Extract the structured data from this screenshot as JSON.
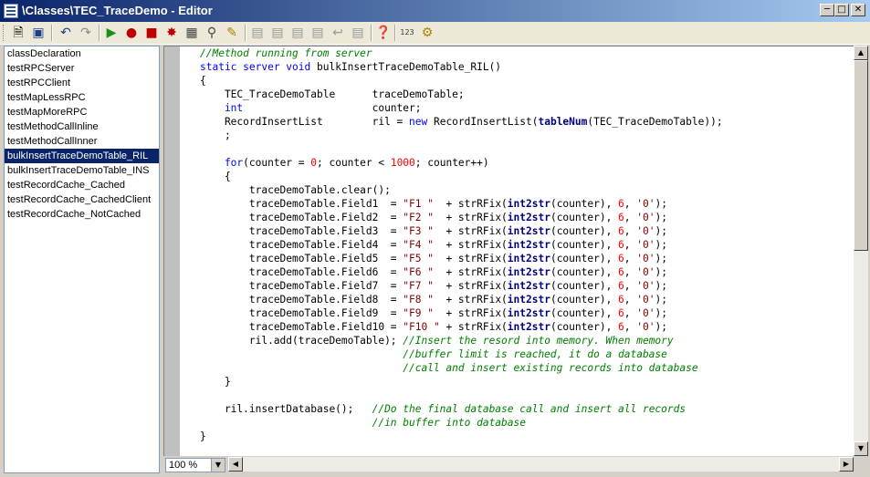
{
  "window": {
    "title": "\\Classes\\TEC_TraceDemo - Editor"
  },
  "toolbar": {
    "icons": [
      "new-icon",
      "save-icon",
      "undo-icon",
      "redo-icon",
      "run-icon",
      "stop-icon",
      "breakpoint-icon",
      "remove-breakpoints-icon",
      "compile-icon",
      "find-icon",
      "replace-icon",
      "lookup-properties-icon",
      "lookup-methods-icon",
      "lookup-labels-icon",
      "comment-icon",
      "uncomment-icon",
      "scripts-icon",
      "help-icon",
      "line-numbers-icon",
      "code-profile-icon"
    ]
  },
  "methods": [
    {
      "label": "classDeclaration"
    },
    {
      "label": "testRPCServer"
    },
    {
      "label": "testRPCClient"
    },
    {
      "label": "testMapLessRPC"
    },
    {
      "label": "testMapMoreRPC"
    },
    {
      "label": "testMethodCallInline"
    },
    {
      "label": "testMethodCallInner"
    },
    {
      "label": "bulkInsertTraceDemoTable_RIL",
      "selected": true
    },
    {
      "label": "bulkInsertTraceDemoTable_INS"
    },
    {
      "label": "testRecordCache_Cached"
    },
    {
      "label": "testRecordCache_CachedClient"
    },
    {
      "label": "testRecordCache_NotCached"
    }
  ],
  "code": {
    "lines": [
      [
        [
          "cm",
          "//Method running from server"
        ]
      ],
      [
        [
          "kw",
          "static server void "
        ],
        [
          "",
          "bulkInsertTraceDemoTable_RIL()"
        ]
      ],
      [
        [
          "",
          "{"
        ]
      ],
      [
        [
          "",
          "    TEC_TraceDemoTable      traceDemoTable;"
        ]
      ],
      [
        [
          "kw",
          "    int"
        ],
        [
          "",
          "                     counter;"
        ]
      ],
      [
        [
          "",
          "    RecordInsertList        ril = "
        ],
        [
          "kw",
          "new"
        ],
        [
          "",
          " RecordInsertList("
        ],
        [
          "fn",
          "tableNum"
        ],
        [
          "",
          "(TEC_TraceDemoTable));"
        ]
      ],
      [
        [
          "",
          "    ;"
        ]
      ],
      [
        [
          "",
          "    "
        ]
      ],
      [
        [
          "kw",
          "    for"
        ],
        [
          "",
          "(counter = "
        ],
        [
          "num",
          "0"
        ],
        [
          "",
          "; counter < "
        ],
        [
          "num",
          "1000"
        ],
        [
          "",
          "; counter++)"
        ]
      ],
      [
        [
          "",
          "    {"
        ]
      ],
      [
        [
          "",
          "        traceDemoTable.clear();"
        ]
      ],
      [
        [
          "",
          "        traceDemoTable.Field1  = "
        ],
        [
          "str",
          "\"F1 \""
        ],
        [
          "",
          "  + strRFix("
        ],
        [
          "fn",
          "int2str"
        ],
        [
          "",
          "(counter), "
        ],
        [
          "num",
          "6"
        ],
        [
          ", ",
          ", "
        ],
        [
          "str",
          "'0'"
        ],
        [
          "",
          ");"
        ]
      ],
      [
        [
          "",
          "        traceDemoTable.Field2  = "
        ],
        [
          "str",
          "\"F2 \""
        ],
        [
          "",
          "  + strRFix("
        ],
        [
          "fn",
          "int2str"
        ],
        [
          "",
          "(counter), "
        ],
        [
          "num",
          "6"
        ],
        [
          "",
          ", "
        ],
        [
          "str",
          "'0'"
        ],
        [
          "",
          ");"
        ]
      ],
      [
        [
          "",
          "        traceDemoTable.Field3  = "
        ],
        [
          "str",
          "\"F3 \""
        ],
        [
          "",
          "  + strRFix("
        ],
        [
          "fn",
          "int2str"
        ],
        [
          "",
          "(counter), "
        ],
        [
          "num",
          "6"
        ],
        [
          "",
          ", "
        ],
        [
          "str",
          "'0'"
        ],
        [
          "",
          ");"
        ]
      ],
      [
        [
          "",
          "        traceDemoTable.Field4  = "
        ],
        [
          "str",
          "\"F4 \""
        ],
        [
          "",
          "  + strRFix("
        ],
        [
          "fn",
          "int2str"
        ],
        [
          "",
          "(counter), "
        ],
        [
          "num",
          "6"
        ],
        [
          "",
          ", "
        ],
        [
          "str",
          "'0'"
        ],
        [
          "",
          ");"
        ]
      ],
      [
        [
          "",
          "        traceDemoTable.Field5  = "
        ],
        [
          "str",
          "\"F5 \""
        ],
        [
          "",
          "  + strRFix("
        ],
        [
          "fn",
          "int2str"
        ],
        [
          "",
          "(counter), "
        ],
        [
          "num",
          "6"
        ],
        [
          "",
          ", "
        ],
        [
          "str",
          "'0'"
        ],
        [
          "",
          ");"
        ]
      ],
      [
        [
          "",
          "        traceDemoTable.Field6  = "
        ],
        [
          "str",
          "\"F6 \""
        ],
        [
          "",
          "  + strRFix("
        ],
        [
          "fn",
          "int2str"
        ],
        [
          "",
          "(counter), "
        ],
        [
          "num",
          "6"
        ],
        [
          "",
          ", "
        ],
        [
          "str",
          "'0'"
        ],
        [
          "",
          ");"
        ]
      ],
      [
        [
          "",
          "        traceDemoTable.Field7  = "
        ],
        [
          "str",
          "\"F7 \""
        ],
        [
          "",
          "  + strRFix("
        ],
        [
          "fn",
          "int2str"
        ],
        [
          "",
          "(counter), "
        ],
        [
          "num",
          "6"
        ],
        [
          "",
          ", "
        ],
        [
          "str",
          "'0'"
        ],
        [
          "",
          ");"
        ]
      ],
      [
        [
          "",
          "        traceDemoTable.Field8  = "
        ],
        [
          "str",
          "\"F8 \""
        ],
        [
          "",
          "  + strRFix("
        ],
        [
          "fn",
          "int2str"
        ],
        [
          "",
          "(counter), "
        ],
        [
          "num",
          "6"
        ],
        [
          "",
          ", "
        ],
        [
          "str",
          "'0'"
        ],
        [
          "",
          ");"
        ]
      ],
      [
        [
          "",
          "        traceDemoTable.Field9  = "
        ],
        [
          "str",
          "\"F9 \""
        ],
        [
          "",
          "  + strRFix("
        ],
        [
          "fn",
          "int2str"
        ],
        [
          "",
          "(counter), "
        ],
        [
          "num",
          "6"
        ],
        [
          "",
          ", "
        ],
        [
          "str",
          "'0'"
        ],
        [
          "",
          ");"
        ]
      ],
      [
        [
          "",
          "        traceDemoTable.Field10 = "
        ],
        [
          "str",
          "\"F10 \""
        ],
        [
          "",
          " + strRFix("
        ],
        [
          "fn",
          "int2str"
        ],
        [
          "",
          "(counter), "
        ],
        [
          "num",
          "6"
        ],
        [
          "",
          ", "
        ],
        [
          "str",
          "'0'"
        ],
        [
          "",
          ");"
        ]
      ],
      [
        [
          "",
          "        ril.add(traceDemoTable); "
        ],
        [
          "cm",
          "//Insert the resord into memory. When memory"
        ]
      ],
      [
        [
          "cm",
          "                                 //buffer limit is reached, it do a database"
        ]
      ],
      [
        [
          "cm",
          "                                 //call and insert existing records into database"
        ]
      ],
      [
        [
          "",
          "    }"
        ]
      ],
      [
        [
          "",
          ""
        ]
      ],
      [
        [
          "",
          "    ril.insertDatabase();   "
        ],
        [
          "cm",
          "//Do the final database call and insert all records"
        ]
      ],
      [
        [
          "cm",
          "                            //in buffer into database"
        ]
      ],
      [
        [
          "",
          "}"
        ]
      ]
    ]
  },
  "status": {
    "zoom": "100 %"
  },
  "scrollbar": {
    "vertical_position": 0.0,
    "vertical_thumb_fraction": 0.5
  }
}
